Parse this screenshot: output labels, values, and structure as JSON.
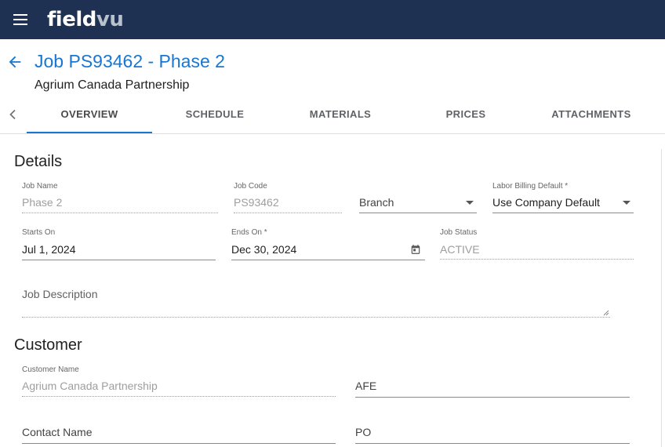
{
  "app": {
    "logo_primary": "field",
    "logo_secondary": "vu"
  },
  "header": {
    "title": "Job PS93462 - Phase 2",
    "subtitle": "Agrium Canada Partnership"
  },
  "tabs": [
    {
      "label": "OVERVIEW",
      "active": true
    },
    {
      "label": "SCHEDULE",
      "active": false
    },
    {
      "label": "MATERIALS",
      "active": false
    },
    {
      "label": "PRICES",
      "active": false
    },
    {
      "label": "ATTACHMENTS",
      "active": false
    }
  ],
  "details": {
    "title": "Details",
    "job_name": {
      "label": "Job Name",
      "value": "Phase 2"
    },
    "job_code": {
      "label": "Job Code",
      "value": "PS93462"
    },
    "branch": {
      "placeholder": "Branch",
      "value": ""
    },
    "labor_billing": {
      "label": "Labor Billing Default *",
      "value": "Use Company Default"
    },
    "starts_on": {
      "label": "Starts On",
      "value": "Jul 1, 2024"
    },
    "ends_on": {
      "label": "Ends On *",
      "value": "Dec 30, 2024"
    },
    "job_status": {
      "label": "Job Status",
      "value": "ACTIVE"
    },
    "job_description": {
      "placeholder": "Job Description",
      "value": ""
    }
  },
  "customer": {
    "title": "Customer",
    "customer_name": {
      "label": "Customer Name",
      "value": "Agrium Canada Partnership"
    },
    "afe": {
      "placeholder": "AFE",
      "value": ""
    },
    "contact_name": {
      "placeholder": "Contact Name",
      "value": ""
    },
    "po": {
      "placeholder": "PO",
      "value": ""
    }
  },
  "colors": {
    "topbar": "#1e3152",
    "accent": "#1976d2",
    "text": "#212121",
    "disabled_text": "#9e9e9e"
  },
  "icons": {
    "menu": "menu-icon",
    "back": "arrow-left-icon",
    "tab_scroll": "chevron-left-icon",
    "calendar": "calendar-icon",
    "dropdown": "caret-down-icon"
  }
}
